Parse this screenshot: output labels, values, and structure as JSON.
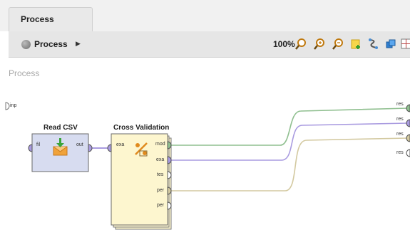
{
  "tab": {
    "label": "Process"
  },
  "toolbar": {
    "process_label": "Process",
    "zoom": "100%"
  },
  "canvas": {
    "title": "Process",
    "input_port": "inp",
    "output_ports": [
      "res",
      "res",
      "res",
      "res"
    ]
  },
  "operators": {
    "read_csv": {
      "name": "Read CSV",
      "in_port": "fil",
      "out_port": "out"
    },
    "cross_validation": {
      "name": "Cross Validation",
      "in_port": "exa",
      "out_ports": [
        "mod",
        "exa",
        "tes",
        "per",
        "per"
      ]
    }
  },
  "colors": {
    "model_wire": "#8fbf8f",
    "example_wire": "#a99be0",
    "performance_wire": "#d3c9a0",
    "operator_blue": "#d7dcf0",
    "operator_yellow": "#fdf6cf"
  }
}
